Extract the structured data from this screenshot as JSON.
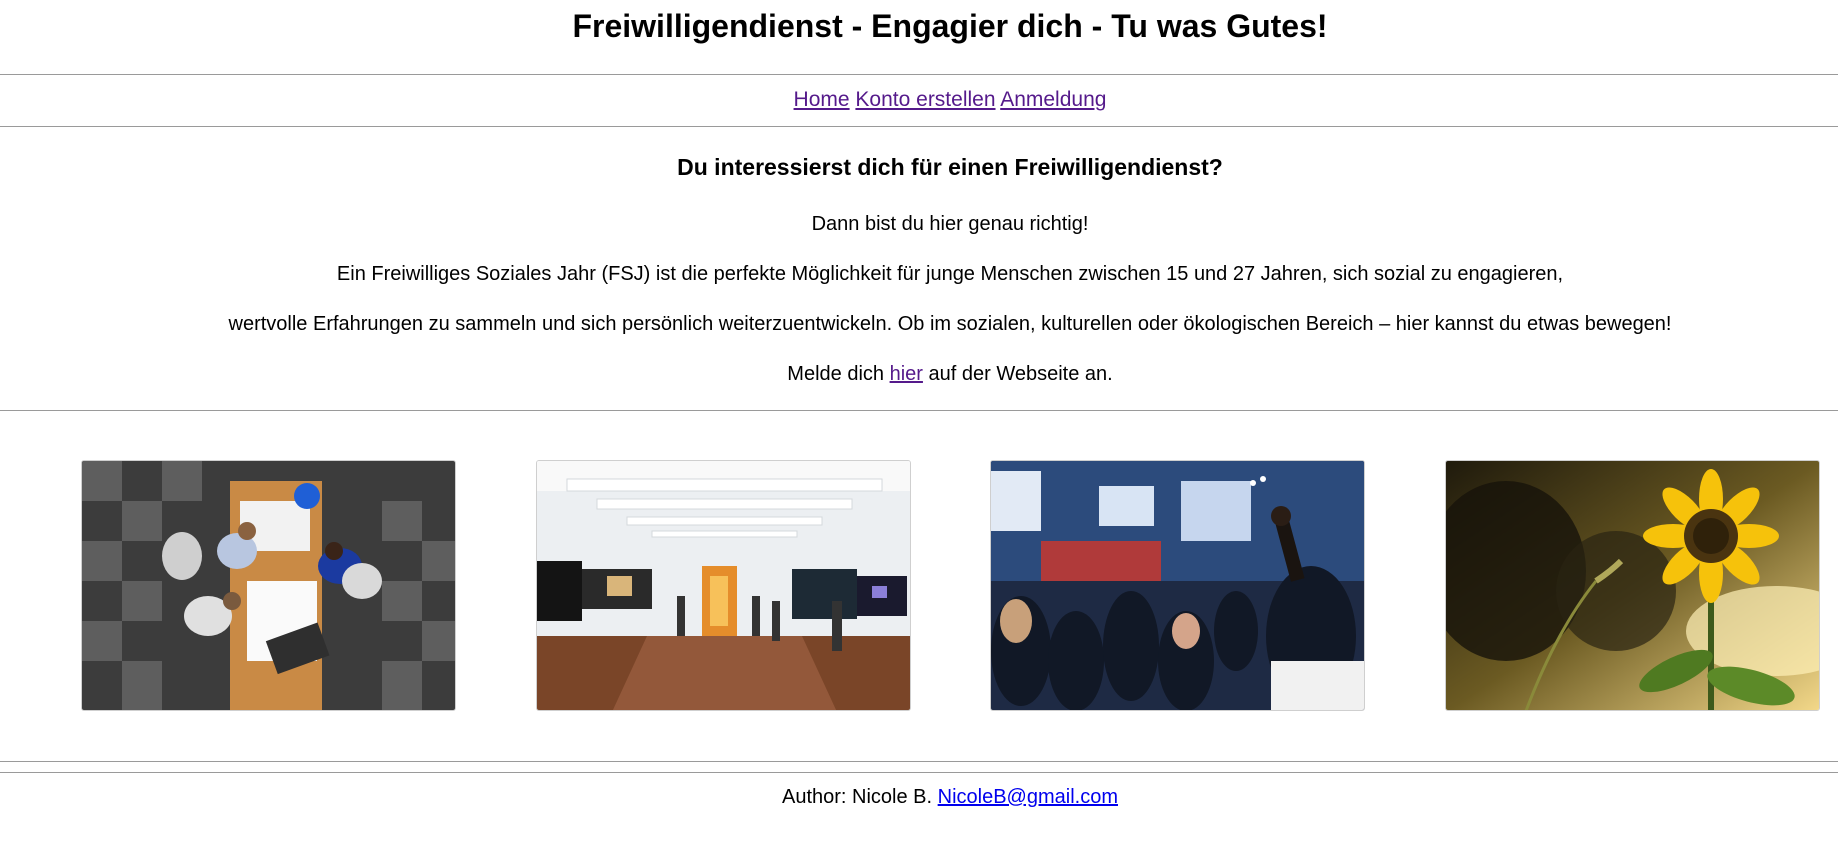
{
  "header": {
    "title": "Freiwilligendienst - Engagier dich - Tu was Gutes!"
  },
  "nav": {
    "items": [
      {
        "label": "Home"
      },
      {
        "label": "Konto erstellen"
      },
      {
        "label": "Anmeldung"
      }
    ]
  },
  "intro": {
    "heading": "Du interessierst dich für einen Freiwilligendienst?",
    "line1": "Dann bist du hier genau richtig!",
    "line2": "Ein Freiwilliges Soziales Jahr (FSJ) ist die perfekte Möglichkeit für junge Menschen zwischen 15 und 27 Jahren, sich sozial zu engagieren,",
    "line3": "wertvolle Erfahrungen zu sammeln und sich persönlich weiterzuentwickeln. Ob im sozialen, kulturellen oder ökologischen Bereich – hier kannst du etwas bewegen!",
    "signup_before": "Melde dich",
    "signup_link": "hier",
    "signup_after": "auf der Webseite an."
  },
  "gallery": {
    "images": [
      {
        "icon": "team-meeting-photo"
      },
      {
        "icon": "art-gallery-photo"
      },
      {
        "icon": "conference-audience-photo"
      },
      {
        "icon": "sunflower-photo"
      }
    ]
  },
  "footer": {
    "author_label": "Author: Nicole B.",
    "email": "NicoleB@gmail.com"
  },
  "colors": {
    "visited_link": "#551a8b",
    "link": "#0000ee",
    "rule": "#9a9a9a"
  }
}
